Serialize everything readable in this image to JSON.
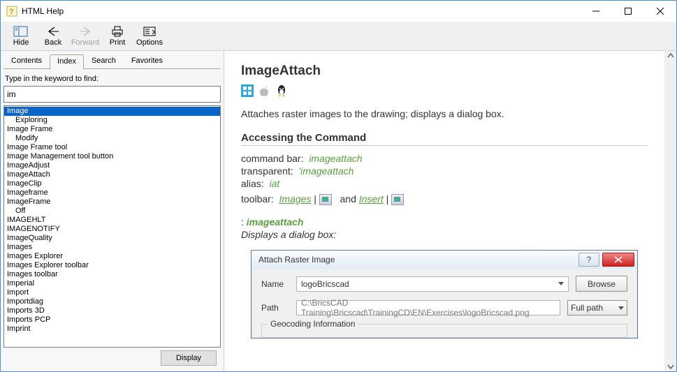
{
  "window": {
    "title": "HTML Help"
  },
  "toolbar": {
    "hide": "Hide",
    "back": "Back",
    "forward": "Forward",
    "print": "Print",
    "options": "Options"
  },
  "nav": {
    "tabs": {
      "contents": "Contents",
      "index": "Index",
      "search": "Search",
      "favorites": "Favorites",
      "active": "Index"
    },
    "prompt": "Type in the keyword to find:",
    "query": "im",
    "display_btn": "Display",
    "items": [
      {
        "label": "Image",
        "selected": true
      },
      {
        "label": "Exploring",
        "sub": true
      },
      {
        "label": "Image Frame"
      },
      {
        "label": "Modify",
        "sub": true
      },
      {
        "label": "Image Frame tool"
      },
      {
        "label": "Image Management tool button"
      },
      {
        "label": "ImageAdjust"
      },
      {
        "label": "ImageAttach"
      },
      {
        "label": "ImageClip"
      },
      {
        "label": "Imageframe"
      },
      {
        "label": "ImageFrame"
      },
      {
        "label": "Off",
        "sub": true
      },
      {
        "label": "IMAGEHLT"
      },
      {
        "label": "IMAGENOTIFY"
      },
      {
        "label": "ImageQuality"
      },
      {
        "label": "Images"
      },
      {
        "label": "Images Explorer"
      },
      {
        "label": "Images Explorer toolbar"
      },
      {
        "label": "Images toolbar"
      },
      {
        "label": "Imperial"
      },
      {
        "label": "Import"
      },
      {
        "label": "Importdiag"
      },
      {
        "label": "Imports 3D"
      },
      {
        "label": "Imports PCP"
      },
      {
        "label": "Imprint"
      }
    ]
  },
  "article": {
    "title": "ImageAttach",
    "lead": "Attaches raster images to the drawing; displays a dialog box.",
    "h2": "Accessing the Command",
    "cmdbar_label": "command bar:",
    "cmdbar_val": "imageattach",
    "transp_label": "transparent:",
    "transp_val": "'imageattach",
    "alias_label": "alias:",
    "alias_val": "iat",
    "toolbar_label": "toolbar:",
    "toolbar_link1": "Images",
    "toolbar_and": "and",
    "toolbar_link2": "Insert",
    "colon": ":",
    "cmd_bold": "imageattach",
    "displays": "Displays a dialog box:"
  },
  "dialog": {
    "title": "Attach Raster Image",
    "name_label": "Name",
    "name_value": "logoBricscad",
    "browse": "Browse",
    "path_label": "Path",
    "path_value": "C:\\BricsCAD Training\\Bricscad\\TrainingCD\\EN\\Exercises\\logoBricscad.png",
    "path_mode": "Full path",
    "geocoding": "Geocoding Information"
  }
}
